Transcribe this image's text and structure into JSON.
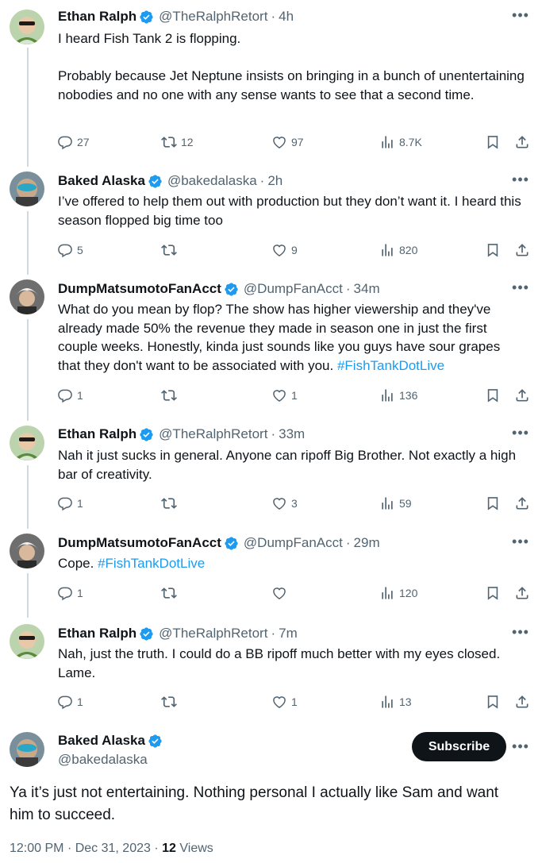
{
  "colors": {
    "accent": "#1d9bf0",
    "verified": "#1d9bf0",
    "secondary_text": "#536471",
    "primary_text": "#0f1419",
    "subscribe_bg": "#0f1419"
  },
  "icons": {
    "reply": "reply-icon",
    "retweet": "retweet-icon",
    "like": "like-icon",
    "views": "views-icon",
    "bookmark": "bookmark-icon",
    "share": "share-icon",
    "more": "more-icon",
    "verified": "verified-badge-icon"
  },
  "more_label": "•••",
  "replies": [
    {
      "name": "Ethan Ralph",
      "handle": "@TheRalphRetort",
      "dot": "·",
      "time": "4h",
      "text": "I heard Fish Tank 2 is flopping.\n\nProbably because Jet Neptune insists on bringing in a bunch of unentertaining nobodies and no one with any sense wants to see that a second time.",
      "hashtag": "",
      "reply_count": "27",
      "retweet_count": "12",
      "like_count": "97",
      "view_count": "8.7K"
    },
    {
      "name": "Baked Alaska",
      "handle": "@bakedalaska",
      "dot": "·",
      "time": "2h",
      "text": "I’ve offered to help them out with production but they don’t want it. I heard this season flopped big time too",
      "hashtag": "",
      "reply_count": "5",
      "retweet_count": "",
      "like_count": "9",
      "view_count": "820"
    },
    {
      "name": "DumpMatsumotoFanAcct",
      "handle": "@DumpFanAcct",
      "dot": "·",
      "time": "34m",
      "text": "What do you mean by flop? The show has higher viewership and they've already made 50% the revenue they made in season one in just the first couple weeks. Honestly, kinda just sounds like you guys have sour grapes that they don't want to be associated with you. ",
      "hashtag": "#FishTankDotLive",
      "reply_count": "1",
      "retweet_count": "",
      "like_count": "1",
      "view_count": "136"
    },
    {
      "name": "Ethan Ralph",
      "handle": "@TheRalphRetort",
      "dot": "·",
      "time": "33m",
      "text": "Nah it just sucks in general. Anyone can ripoff Big Brother. Not exactly a high bar of creativity.",
      "hashtag": "",
      "reply_count": "1",
      "retweet_count": "",
      "like_count": "3",
      "view_count": "59"
    },
    {
      "name": "DumpMatsumotoFanAcct",
      "handle": "@DumpFanAcct",
      "dot": "·",
      "time": "29m",
      "text": "Cope. ",
      "hashtag": "#FishTankDotLive",
      "reply_count": "1",
      "retweet_count": "",
      "like_count": "",
      "view_count": "120"
    },
    {
      "name": "Ethan Ralph",
      "handle": "@TheRalphRetort",
      "dot": "·",
      "time": "7m",
      "text": "Nah, just the truth. I could do a BB ripoff much better with my eyes closed. Lame.",
      "hashtag": "",
      "reply_count": "1",
      "retweet_count": "",
      "like_count": "1",
      "view_count": "13"
    }
  ],
  "main": {
    "name": "Baked Alaska",
    "handle": "@bakedalaska",
    "subscribe_label": "Subscribe",
    "text": "Ya it’s just not entertaining. Nothing personal I actually like Sam and want him to succeed.",
    "time": "12:00 PM",
    "dot": "·",
    "date": "Dec 31, 2023",
    "views_count": "12",
    "views_label": "Views"
  }
}
